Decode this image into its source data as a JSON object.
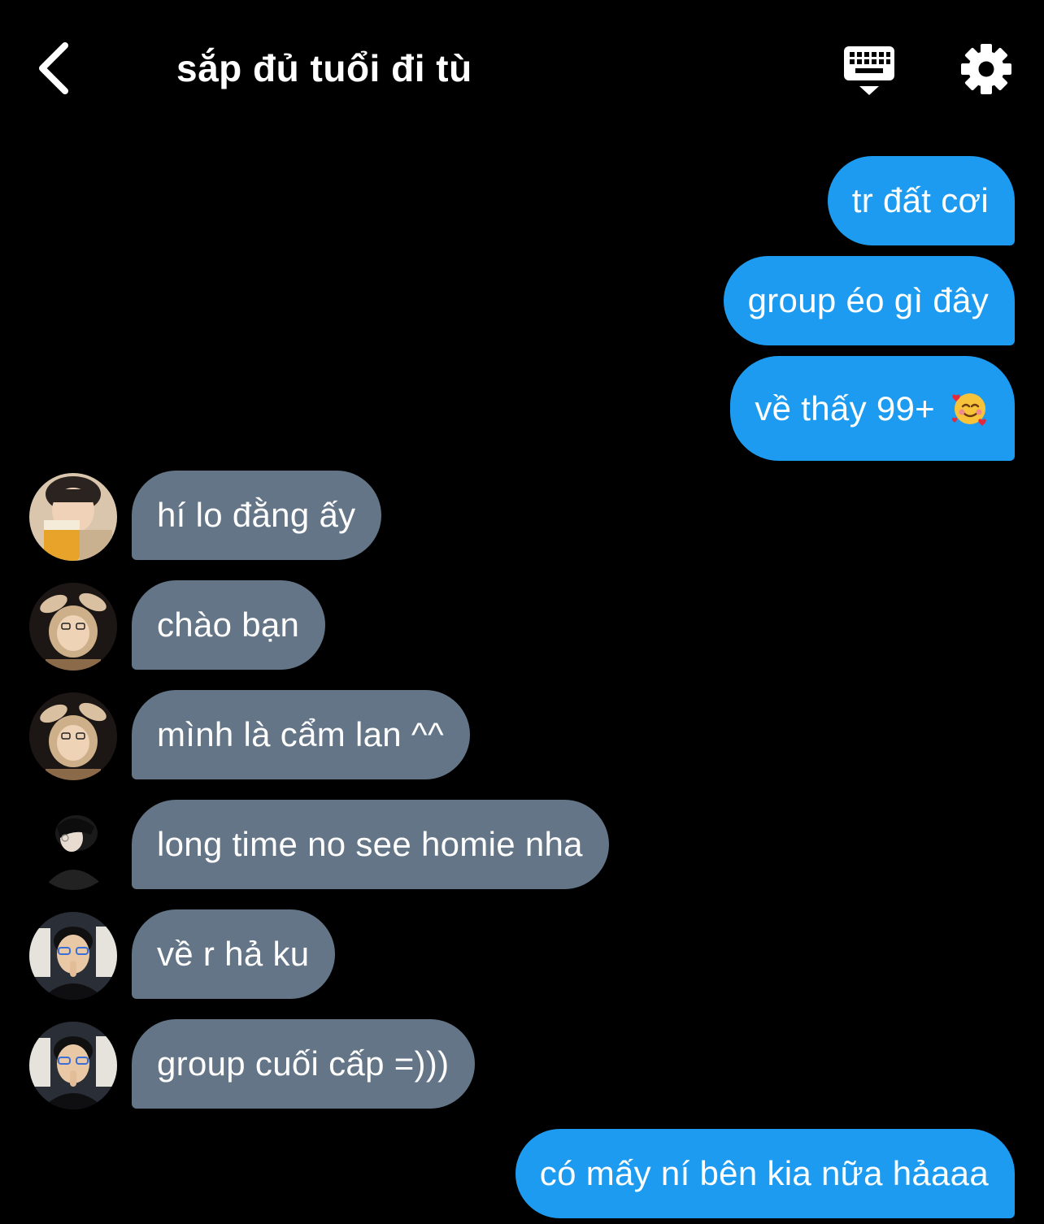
{
  "header": {
    "title": "sắp đủ tuổi đi tù",
    "back_icon": "chevron-left-icon",
    "keyboard_icon": "keyboard-icon",
    "settings_icon": "gear-icon"
  },
  "colors": {
    "background": "#000000",
    "outgoing_bubble": "#1d9bf0",
    "incoming_bubble": "#637586",
    "text": "#ffffff"
  },
  "messages": [
    {
      "direction": "outgoing",
      "text": "tr đất cơi"
    },
    {
      "direction": "outgoing",
      "text": "group éo gì đây"
    },
    {
      "direction": "outgoing",
      "text": "về thấy 99+",
      "emoji": "smiling-face-with-hearts"
    },
    {
      "direction": "incoming",
      "text": "hí lo đằng ấy"
    },
    {
      "direction": "incoming",
      "text": "chào bạn"
    },
    {
      "direction": "incoming",
      "text": "mình là cẩm lan ^^"
    },
    {
      "direction": "incoming",
      "text": "long time no see homie nha"
    },
    {
      "direction": "incoming",
      "text": "về r hả ku"
    },
    {
      "direction": "incoming",
      "text": "group cuối cấp =)))"
    },
    {
      "direction": "outgoing",
      "text": "có mấy ní bên kia nữa hảaaa"
    }
  ]
}
